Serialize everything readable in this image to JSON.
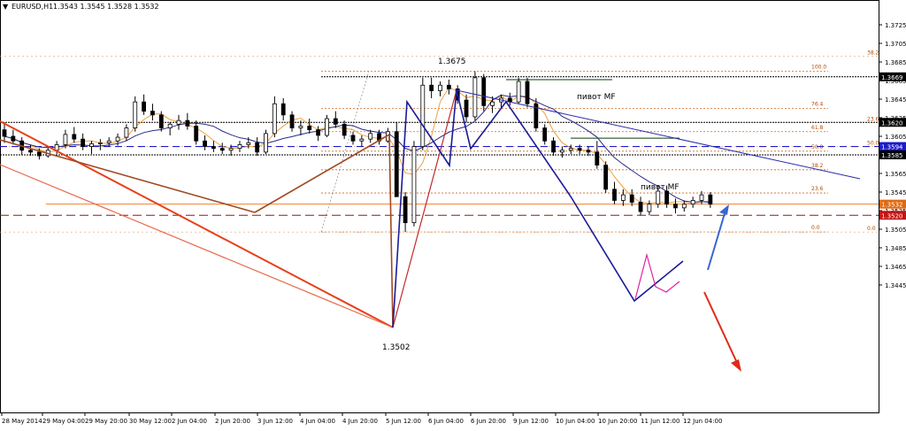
{
  "header": {
    "arrow": "▼",
    "symbol": "EURUSD,H1",
    "ohlc": "1.3543 1.3545 1.3528 1.3532"
  },
  "chart_data": {
    "type": "candlestick",
    "title": "EURUSD,H1",
    "ylim": [
      1.3445,
      1.3765
    ],
    "y_ticks": [
      "1.3725",
      "1.3705",
      "1.3685",
      "1.3665",
      "1.3645",
      "1.3625",
      "1.3605",
      "1.3585",
      "1.3565",
      "1.3545",
      "1.3525",
      "1.3505",
      "1.3485",
      "1.3465",
      "1.3445"
    ],
    "x_ticks": [
      "28 May 2014",
      "29 May 04:00",
      "29 May 20:00",
      "30 May 12:00",
      "2 Jun 04:00",
      "2 Jun 20:00",
      "3 Jun 12:00",
      "4 Jun 04:00",
      "4 Jun 20:00",
      "5 Jun 12:00",
      "6 Jun 04:00",
      "6 Jun 20:00",
      "9 Jun 12:00",
      "10 Jun 04:00",
      "10 Jun 20:00",
      "11 Jun 12:00",
      "12 Jun 04:00"
    ],
    "price_marks": [
      {
        "value": 1.3669,
        "label": "1.3669",
        "color": "#000000"
      },
      {
        "value": 1.362,
        "label": "1.3620",
        "color": "#000000"
      },
      {
        "value": 1.3594,
        "label": "1.3594",
        "color": "#1c1cc8"
      },
      {
        "value": 1.3585,
        "label": "1.3585",
        "color": "#000000"
      },
      {
        "value": 1.3532,
        "label": "1.3532",
        "color": "#e06a10"
      },
      {
        "value": 1.352,
        "label": "1.3520",
        "color": "#c41414"
      }
    ],
    "fib_levels": [
      {
        "label": "100.0",
        "value": 1.3675
      },
      {
        "label": "76.4",
        "value": 1.3635
      },
      {
        "label": "61.8",
        "value": 1.361
      },
      {
        "label": "50.0",
        "value": 1.3589
      },
      {
        "label": "38.2",
        "value": 1.3569
      },
      {
        "label": "23.6",
        "value": 1.3544
      },
      {
        "label": "0.0",
        "value": 1.3502
      }
    ],
    "fib_extra": [
      {
        "label": "38.2",
        "value": 1.3691
      },
      {
        "label": "23.6",
        "value": 1.362
      },
      {
        "label": "50.0",
        "value": 1.3594
      },
      {
        "label": "0.0",
        "value": 1.3502
      }
    ],
    "annotations": [
      {
        "text": "1.3675"
      },
      {
        "text": "1.3502"
      },
      {
        "text": "пивот MF"
      },
      {
        "text": "пивот MF"
      }
    ],
    "candles": [
      [
        1.3612,
        1.362,
        1.3598,
        1.3605
      ],
      [
        1.3605,
        1.3612,
        1.3596,
        1.36
      ],
      [
        1.36,
        1.3604,
        1.3585,
        1.359
      ],
      [
        1.359,
        1.3596,
        1.3584,
        1.3588
      ],
      [
        1.3588,
        1.3592,
        1.358,
        1.3584
      ],
      [
        1.3584,
        1.3594,
        1.3582,
        1.359
      ],
      [
        1.359,
        1.36,
        1.3586,
        1.3596
      ],
      [
        1.3596,
        1.3612,
        1.3592,
        1.3607
      ],
      [
        1.3607,
        1.3615,
        1.3598,
        1.3602
      ],
      [
        1.3602,
        1.3608,
        1.359,
        1.3594
      ],
      [
        1.3594,
        1.36,
        1.3586,
        1.3597
      ],
      [
        1.3597,
        1.3602,
        1.359,
        1.3598
      ],
      [
        1.3598,
        1.3604,
        1.3594,
        1.36
      ],
      [
        1.36,
        1.3608,
        1.3595,
        1.3604
      ],
      [
        1.3604,
        1.3618,
        1.36,
        1.3614
      ],
      [
        1.3614,
        1.3648,
        1.361,
        1.3642
      ],
      [
        1.3642,
        1.365,
        1.3628,
        1.3632
      ],
      [
        1.3632,
        1.364,
        1.3622,
        1.3628
      ],
      [
        1.3628,
        1.3632,
        1.361,
        1.3614
      ],
      [
        1.3614,
        1.362,
        1.3606,
        1.3618
      ],
      [
        1.3618,
        1.3628,
        1.3612,
        1.3622
      ],
      [
        1.3622,
        1.363,
        1.3612,
        1.3616
      ],
      [
        1.3616,
        1.3622,
        1.3596,
        1.36
      ],
      [
        1.36,
        1.3606,
        1.359,
        1.3594
      ],
      [
        1.3594,
        1.36,
        1.3588,
        1.3592
      ],
      [
        1.3592,
        1.3598,
        1.3586,
        1.359
      ],
      [
        1.359,
        1.3596,
        1.3584,
        1.3592
      ],
      [
        1.3592,
        1.36,
        1.3588,
        1.3596
      ],
      [
        1.3596,
        1.3604,
        1.3592,
        1.3598
      ],
      [
        1.3598,
        1.3604,
        1.3584,
        1.3588
      ],
      [
        1.3588,
        1.3612,
        1.3586,
        1.3608
      ],
      [
        1.3608,
        1.3648,
        1.3604,
        1.364
      ],
      [
        1.364,
        1.3646,
        1.3622,
        1.3628
      ],
      [
        1.3628,
        1.3632,
        1.361,
        1.3614
      ],
      [
        1.3614,
        1.3622,
        1.3606,
        1.3616
      ],
      [
        1.3616,
        1.3624,
        1.3608,
        1.3612
      ],
      [
        1.3612,
        1.3616,
        1.36,
        1.3606
      ],
      [
        1.3606,
        1.3628,
        1.3604,
        1.3624
      ],
      [
        1.3624,
        1.3632,
        1.3614,
        1.3618
      ],
      [
        1.3618,
        1.3622,
        1.3602,
        1.3606
      ],
      [
        1.3606,
        1.361,
        1.3596,
        1.36
      ],
      [
        1.36,
        1.3606,
        1.3594,
        1.3602
      ],
      [
        1.3602,
        1.3612,
        1.3598,
        1.3608
      ],
      [
        1.3608,
        1.3612,
        1.3596,
        1.36
      ],
      [
        1.36,
        1.3614,
        1.3598,
        1.361
      ],
      [
        1.361,
        1.362,
        1.359,
        1.354
      ],
      [
        1.354,
        1.3545,
        1.3502,
        1.3512
      ],
      [
        1.3512,
        1.36,
        1.3508,
        1.3594
      ],
      [
        1.3594,
        1.3668,
        1.359,
        1.366
      ],
      [
        1.366,
        1.3668,
        1.3646,
        1.3654
      ],
      [
        1.3654,
        1.3664,
        1.3648,
        1.366
      ],
      [
        1.366,
        1.3666,
        1.365,
        1.3656
      ],
      [
        1.3656,
        1.366,
        1.364,
        1.3644
      ],
      [
        1.3644,
        1.365,
        1.362,
        1.3626
      ],
      [
        1.3626,
        1.3675,
        1.3622,
        1.3668
      ],
      [
        1.3668,
        1.3672,
        1.3632,
        1.3638
      ],
      [
        1.3638,
        1.3648,
        1.363,
        1.3642
      ],
      [
        1.3642,
        1.365,
        1.3636,
        1.3646
      ],
      [
        1.3646,
        1.3652,
        1.3638,
        1.3642
      ],
      [
        1.3642,
        1.3668,
        1.364,
        1.3664
      ],
      [
        1.3664,
        1.3668,
        1.3636,
        1.364
      ],
      [
        1.364,
        1.3646,
        1.361,
        1.3614
      ],
      [
        1.3614,
        1.3618,
        1.3596,
        1.36
      ],
      [
        1.36,
        1.3604,
        1.3584,
        1.3588
      ],
      [
        1.3588,
        1.3594,
        1.3582,
        1.359
      ],
      [
        1.359,
        1.3596,
        1.3586,
        1.3592
      ],
      [
        1.3592,
        1.3596,
        1.3586,
        1.359
      ],
      [
        1.359,
        1.3594,
        1.3584,
        1.3588
      ],
      [
        1.3588,
        1.36,
        1.357,
        1.3574
      ],
      [
        1.3574,
        1.3578,
        1.3544,
        1.3548
      ],
      [
        1.3548,
        1.3556,
        1.3532,
        1.3536
      ],
      [
        1.3536,
        1.3548,
        1.353,
        1.3542
      ],
      [
        1.3542,
        1.3548,
        1.353,
        1.3534
      ],
      [
        1.3534,
        1.354,
        1.352,
        1.3524
      ],
      [
        1.3524,
        1.3536,
        1.352,
        1.3532
      ],
      [
        1.3532,
        1.3552,
        1.3528,
        1.3546
      ],
      [
        1.3546,
        1.3552,
        1.3528,
        1.3532
      ],
      [
        1.3532,
        1.3538,
        1.3522,
        1.3528
      ],
      [
        1.3528,
        1.3536,
        1.3524,
        1.3532
      ],
      [
        1.3532,
        1.354,
        1.3528,
        1.3536
      ],
      [
        1.3536,
        1.3546,
        1.3532,
        1.3542
      ],
      [
        1.3542,
        1.3545,
        1.3528,
        1.3532
      ]
    ]
  }
}
